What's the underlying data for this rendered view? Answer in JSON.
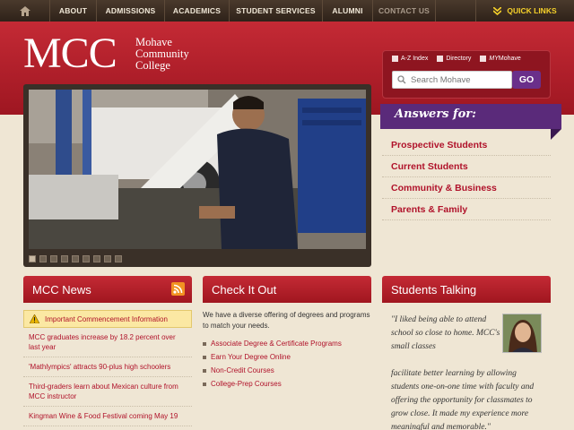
{
  "nav": {
    "home_icon": "home-icon",
    "items": [
      "ABOUT",
      "ADMISSIONS",
      "ACADEMICS",
      "STUDENT SERVICES",
      "ALUMNI",
      "CONTACT US"
    ],
    "quick_links": "QUICK LINKS"
  },
  "header": {
    "logo_mcc": "MCC",
    "logo_line1": "Mohave",
    "logo_line2": "Community",
    "logo_line3": "College"
  },
  "search": {
    "az_index": "A-Z Index",
    "directory": "Directory",
    "mymohave_my": "MY",
    "mymohave": "Mohave",
    "placeholder": "Search Mohave",
    "go": "GO"
  },
  "answers": {
    "title": "Answers for:",
    "items": [
      "Prospective Students",
      "Current Students",
      "Community & Business",
      "Parents & Family"
    ]
  },
  "news": {
    "title": "MCC News",
    "notice": "Important Commencement Information",
    "items": [
      "MCC graduates increase by 18.2 percent over last year",
      "'Mathlympics' attracts 90-plus high schoolers",
      "Third-graders learn about Mexican culture from MCC instructor",
      "Kingman Wine & Food Festival coming May 19"
    ]
  },
  "check": {
    "title": "Check It Out",
    "intro": "We have a diverse offering of degrees and programs to match your needs.",
    "items": [
      "Associate Degree & Certificate Programs",
      "Earn Your Degree Online",
      "Non-Credit Courses",
      "College-Prep Courses"
    ]
  },
  "students": {
    "title": "Students Talking",
    "quote_part1": "\"I liked being able to attend school so close to home. MCC's small classes",
    "quote_part2": "facilitate better learning by allowing students one-on-one time with faculty and offering the opportunity for classmates to grow close. It made my experience more meaningful and memorable.\""
  },
  "colors": {
    "brand_red": "#b0122a",
    "purple": "#5a2a7a",
    "nav_dark": "#2e2219",
    "quick_links_yellow": "#f6d12a"
  }
}
